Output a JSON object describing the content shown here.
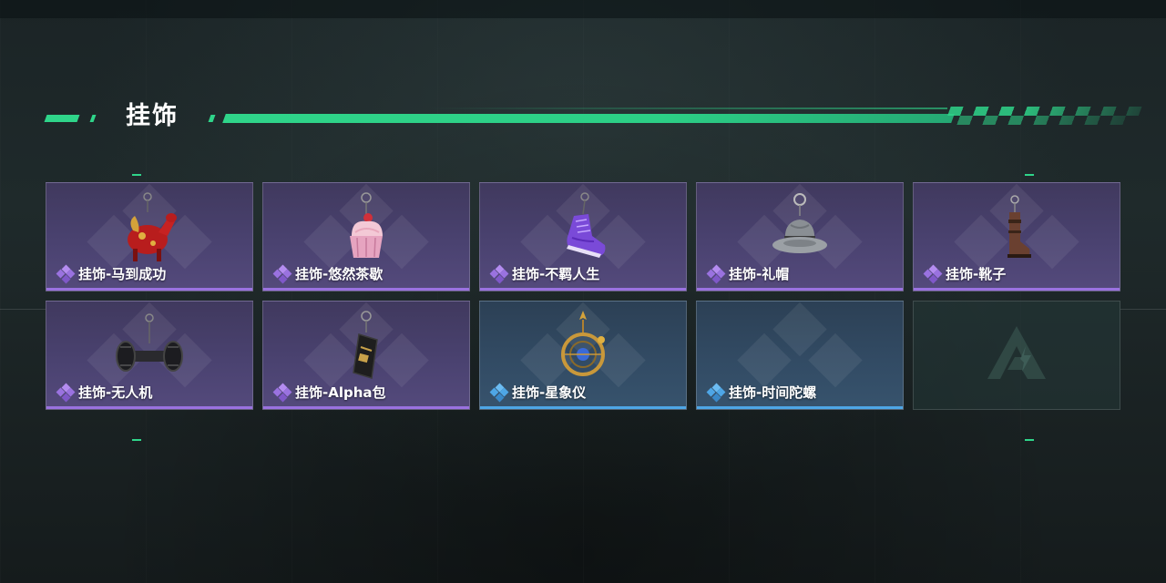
{
  "section": {
    "title": "挂饰"
  },
  "colors": {
    "accent": "#2fd58a",
    "rarity_purple": "#9a72e0",
    "rarity_blue": "#4ea6e6"
  },
  "items": [
    {
      "name": "挂饰-马到成功",
      "rarity": "purple",
      "icon": "red-horse-charm-icon"
    },
    {
      "name": "挂饰-悠然茶歇",
      "rarity": "purple",
      "icon": "cupcake-charm-icon"
    },
    {
      "name": "挂饰-不羁人生",
      "rarity": "purple",
      "icon": "purple-sneaker-charm-icon"
    },
    {
      "name": "挂饰-礼帽",
      "rarity": "purple",
      "icon": "fedora-hat-charm-icon"
    },
    {
      "name": "挂饰-靴子",
      "rarity": "purple",
      "icon": "boot-charm-icon"
    },
    {
      "name": "挂饰-无人机",
      "rarity": "purple",
      "icon": "drone-charm-icon"
    },
    {
      "name": "挂饰-Alpha包",
      "rarity": "purple",
      "icon": "alpha-pouch-charm-icon"
    },
    {
      "name": "挂饰-星象仪",
      "rarity": "blue",
      "icon": "astrolabe-charm-icon"
    },
    {
      "name": "挂饰-时间陀螺",
      "rarity": "blue",
      "icon": "spinning-top-charm-icon"
    }
  ],
  "empty_slot": {
    "icon": "game-logo-icon"
  }
}
